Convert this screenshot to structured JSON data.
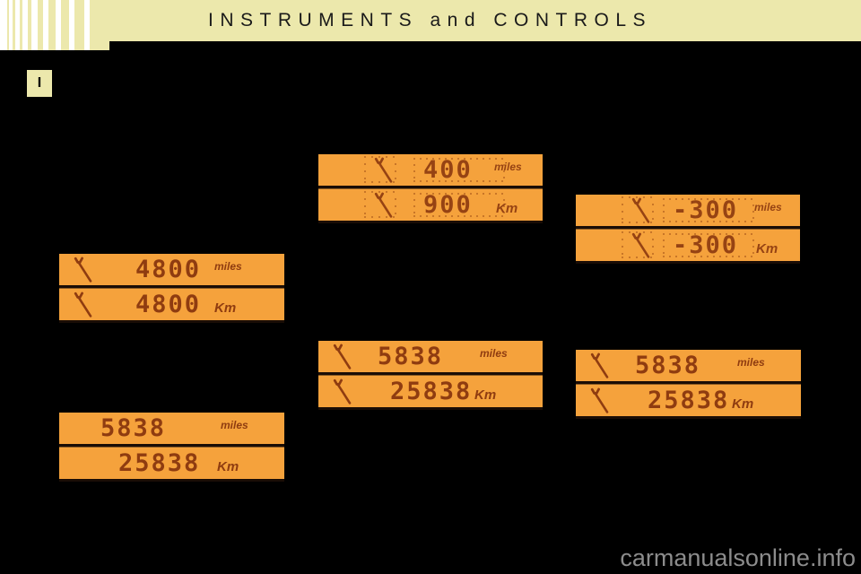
{
  "header": {
    "title": "INSTRUMENTS and CONTROLS",
    "band_color": "#ece8ac",
    "stripe_color": "#ece8ac",
    "stripe_gap_color": "#ffffff",
    "section_tab_label": "I"
  },
  "colors": {
    "page_background": "#000000",
    "lcd_background": "#f5a23c",
    "lcd_digit": "#8f3c10",
    "lcd_frame": "#1a0d06",
    "watermark": "#8c8c8c"
  },
  "watermark": "carmanualsonline.info",
  "panels": [
    {
      "id": "panel-top-middle",
      "name": "service-due-400-miles-blinking",
      "blinking": true,
      "has_wrench_icon": true,
      "icon_name": "wrench-icon",
      "rows": [
        {
          "value": "400",
          "unit": "miles"
        },
        {
          "value": "900",
          "unit": "Km"
        }
      ]
    },
    {
      "id": "panel-middle-right-upper",
      "name": "service-overdue-minus-300-blinking",
      "blinking": true,
      "has_wrench_icon": true,
      "icon_name": "wrench-icon",
      "rows": [
        {
          "value": "-300",
          "unit": "miles"
        },
        {
          "value": "-300",
          "unit": "Km"
        }
      ]
    },
    {
      "id": "panel-left-upper",
      "name": "service-interval-4800",
      "blinking": false,
      "has_wrench_icon": true,
      "icon_name": "wrench-icon",
      "rows": [
        {
          "value": "4800",
          "unit": "miles"
        },
        {
          "value": "4800",
          "unit": "Km"
        }
      ]
    },
    {
      "id": "panel-middle-lower",
      "name": "odometer-with-service-indicator-5838",
      "blinking": false,
      "has_wrench_icon": true,
      "icon_name": "wrench-icon",
      "rows": [
        {
          "value": "5838",
          "unit": "miles"
        },
        {
          "value": "25838",
          "unit": "Km"
        }
      ]
    },
    {
      "id": "panel-right-lower",
      "name": "odometer-with-service-indicator-5838-right",
      "blinking": false,
      "has_wrench_icon": true,
      "icon_name": "wrench-icon",
      "rows": [
        {
          "value": "5838",
          "unit": "miles"
        },
        {
          "value": "25838",
          "unit": "Km"
        }
      ]
    },
    {
      "id": "panel-left-lower",
      "name": "odometer-only-5838",
      "blinking": false,
      "has_wrench_icon": false,
      "icon_name": "",
      "rows": [
        {
          "value": "5838",
          "unit": "miles"
        },
        {
          "value": "25838",
          "unit": "Km"
        }
      ]
    }
  ]
}
